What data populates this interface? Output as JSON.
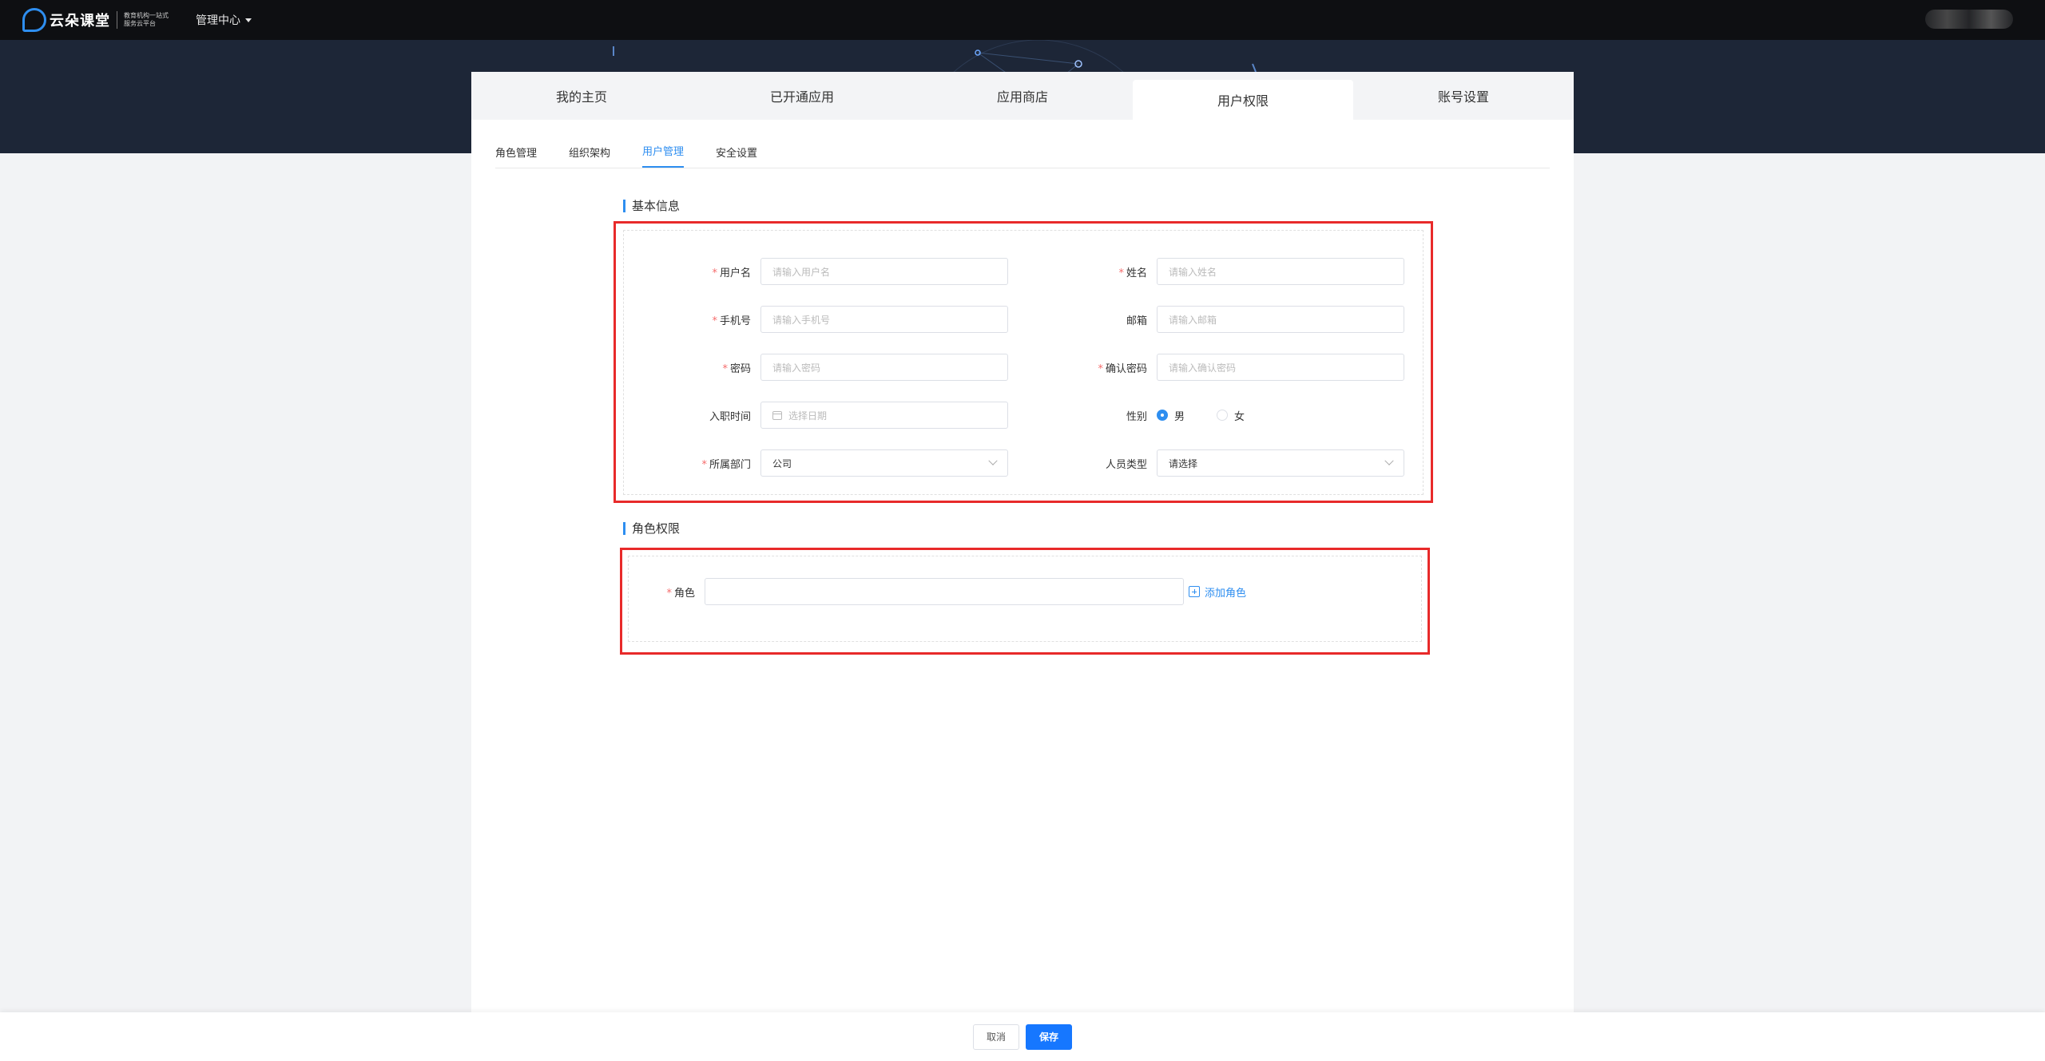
{
  "topbar": {
    "logo_name": "云朵课堂",
    "logo_slogan": "教育机构一站式服务云平台",
    "menu_label": "管理中心"
  },
  "tabs": [
    {
      "label": "我的主页"
    },
    {
      "label": "已开通应用"
    },
    {
      "label": "应用商店"
    },
    {
      "label": "用户权限",
      "active": true
    },
    {
      "label": "账号设置"
    }
  ],
  "subtabs": [
    {
      "label": "角色管理"
    },
    {
      "label": "组织架构"
    },
    {
      "label": "用户管理",
      "active": true
    },
    {
      "label": "安全设置"
    }
  ],
  "basic_info": {
    "title": "基本信息",
    "username": {
      "label": "用户名",
      "placeholder": "请输入用户名",
      "required": true
    },
    "name": {
      "label": "姓名",
      "placeholder": "请输入姓名",
      "required": true
    },
    "phone": {
      "label": "手机号",
      "placeholder": "请输入手机号",
      "required": true
    },
    "email": {
      "label": "邮箱",
      "placeholder": "请输入邮箱",
      "required": false
    },
    "password": {
      "label": "密码",
      "placeholder": "请输入密码",
      "required": true
    },
    "confirm_password": {
      "label": "确认密码",
      "placeholder": "请输入确认密码",
      "required": true
    },
    "hire_date": {
      "label": "入职时间",
      "placeholder": "选择日期"
    },
    "gender": {
      "label": "性别",
      "options": [
        "男",
        "女"
      ],
      "selected": "男"
    },
    "department": {
      "label": "所属部门",
      "value": "公司",
      "required": true
    },
    "staff_type": {
      "label": "人员类型",
      "placeholder": "请选择"
    }
  },
  "role_perm": {
    "title": "角色权限",
    "role": {
      "label": "角色",
      "value": "",
      "required": true
    },
    "add_role_label": "添加角色"
  },
  "footer": {
    "cancel_label": "取消",
    "save_label": "保存"
  },
  "colors": {
    "accent": "#2e8ef0",
    "highlight_border": "#e82a2a",
    "topbar": "#0e0f12",
    "hero": "#1d2637"
  }
}
